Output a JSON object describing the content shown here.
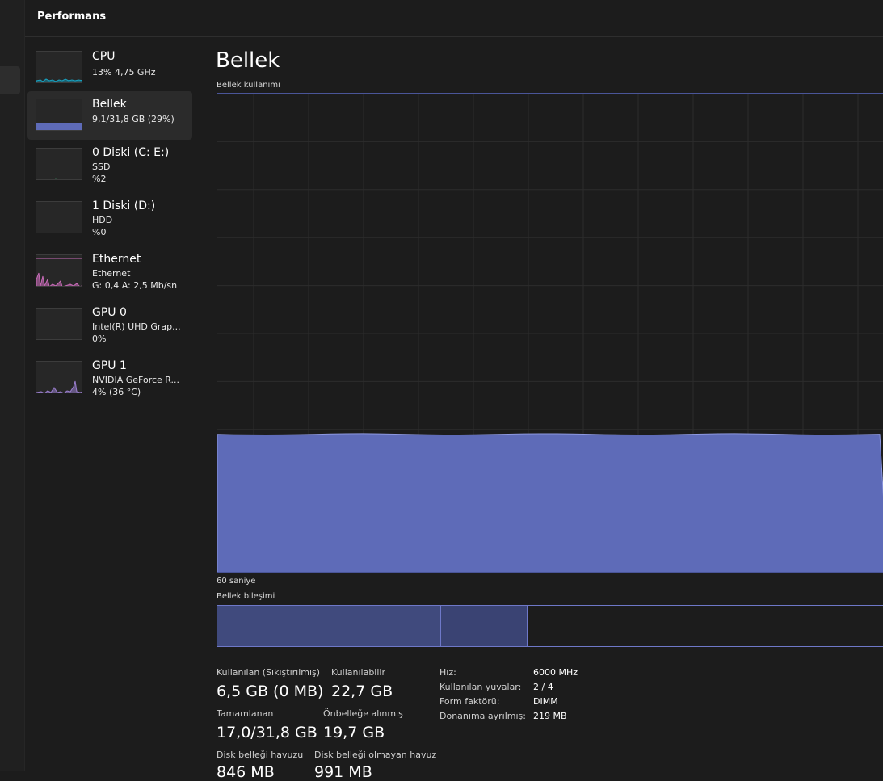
{
  "app": {
    "section_title": "Performans"
  },
  "sidebar": {
    "items": [
      {
        "name": "CPU",
        "sub1": "13%  4,75 GHz",
        "sub2": ""
      },
      {
        "name": "Bellek",
        "sub1": "9,1/31,8 GB (29%)",
        "sub2": ""
      },
      {
        "name": "0 Diski (C: E:)",
        "sub1": "SSD",
        "sub2": "%2"
      },
      {
        "name": "1 Diski (D:)",
        "sub1": "HDD",
        "sub2": "%0"
      },
      {
        "name": "Ethernet",
        "sub1": "Ethernet",
        "sub2": "G: 0,4  A: 2,5 Mb/sn"
      },
      {
        "name": "GPU 0",
        "sub1": "Intel(R) UHD Grap...",
        "sub2": "0%"
      },
      {
        "name": "GPU 1",
        "sub1": "NVIDIA GeForce R...",
        "sub2": "4%  (36 °C)"
      }
    ]
  },
  "main": {
    "title": "Bellek",
    "usage_label": "Bellek kullanımı",
    "time_label": "60 saniye",
    "composition_label": "Bellek bileşimi",
    "usage_percent": 29,
    "composition": {
      "in_use_fraction": 0.333,
      "modified_fraction": 0.128
    }
  },
  "stats": {
    "in_use_label": "Kullanılan (Sıkıştırılmış)",
    "in_use_value": "6,5 GB (0 MB)",
    "available_label": "Kullanılabilir",
    "available_value": "22,7 GB",
    "committed_label": "Tamamlanan",
    "committed_value": "17,0/31,8 GB",
    "cached_label": "Önbelleğe alınmış",
    "cached_value": "19,7 GB",
    "paged_label": "Disk belleği havuzu",
    "paged_value": "846 MB",
    "nonpaged_label": "Disk belleği olmayan havuz",
    "nonpaged_value": "991 MB"
  },
  "specs": {
    "speed_label": "Hız:",
    "speed_value": "6000 MHz",
    "slots_label": "Kullanılan yuvalar:",
    "slots_value": "2 / 4",
    "form_label": "Form faktörü:",
    "form_value": "DIMM",
    "reserved_label": "Donanıma ayrılmış:",
    "reserved_value": "219 MB"
  },
  "colors": {
    "memory": "#5e6bb8",
    "cpu": "#17a4c4",
    "disk": "#3fa06b",
    "ethernet": "#c86bb8",
    "gpu": "#9b7fd0"
  }
}
